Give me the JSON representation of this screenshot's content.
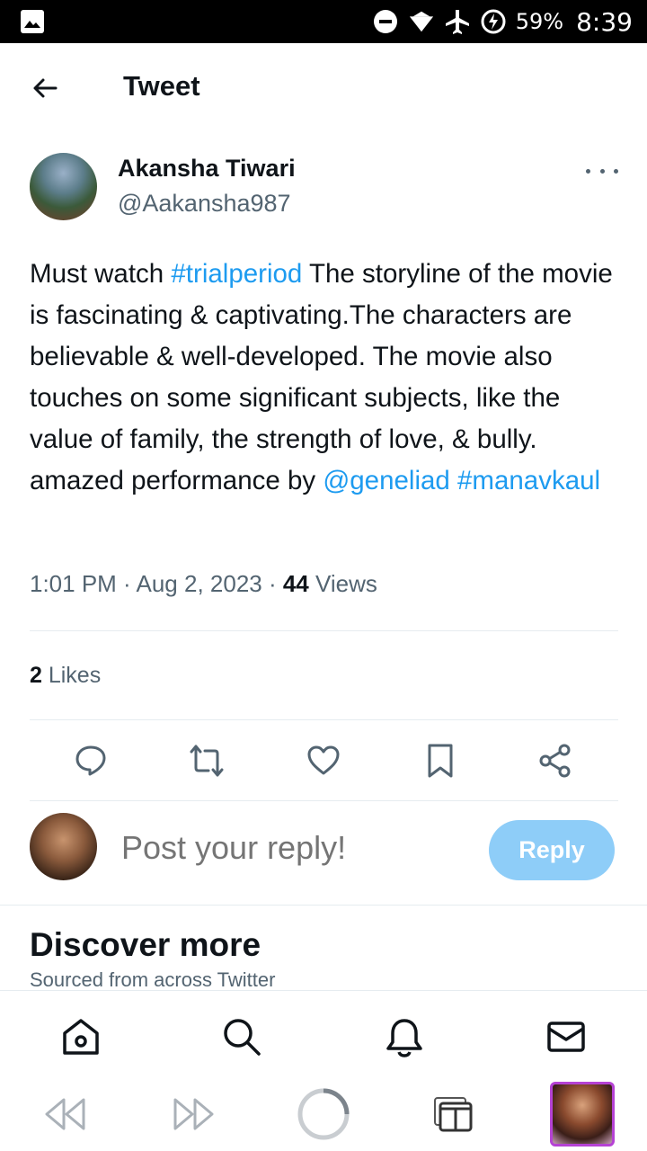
{
  "status_bar": {
    "battery": "59%",
    "time": "8:39",
    "icons": [
      "gallery-icon",
      "dnd-icon",
      "wifi-icon",
      "airplane-icon",
      "battery-saver-icon"
    ]
  },
  "header": {
    "title": "Tweet"
  },
  "tweet": {
    "author_name": "Akansha Tiwari",
    "author_handle": "@Aakansha987",
    "text_parts": {
      "p1": "Must watch ",
      "hashtag1": "#trialperiod",
      "p2": " The storyline of the movie is fascinating & captivating.The characters are believable & well-developed. The movie also touches on some significant subjects, like the value of family, the strength of love, & bully. amazed performance by ",
      "mention": "@geneliad",
      "p3": " ",
      "hashtag2": "#manavkaul"
    },
    "time": "1:01 PM",
    "date": "Aug 2, 2023",
    "separator": " · ",
    "views_count": "44",
    "views_label": " Views",
    "likes_count": "2",
    "likes_label": " Likes"
  },
  "reply": {
    "placeholder": "Post your reply!",
    "button_label": "Reply"
  },
  "discover": {
    "title": "Discover more",
    "subtitle": "Sourced from across Twitter"
  },
  "colors": {
    "accent": "#1d9bf0",
    "reply_button": "#8ecdf8",
    "secondary_text": "#536471"
  }
}
